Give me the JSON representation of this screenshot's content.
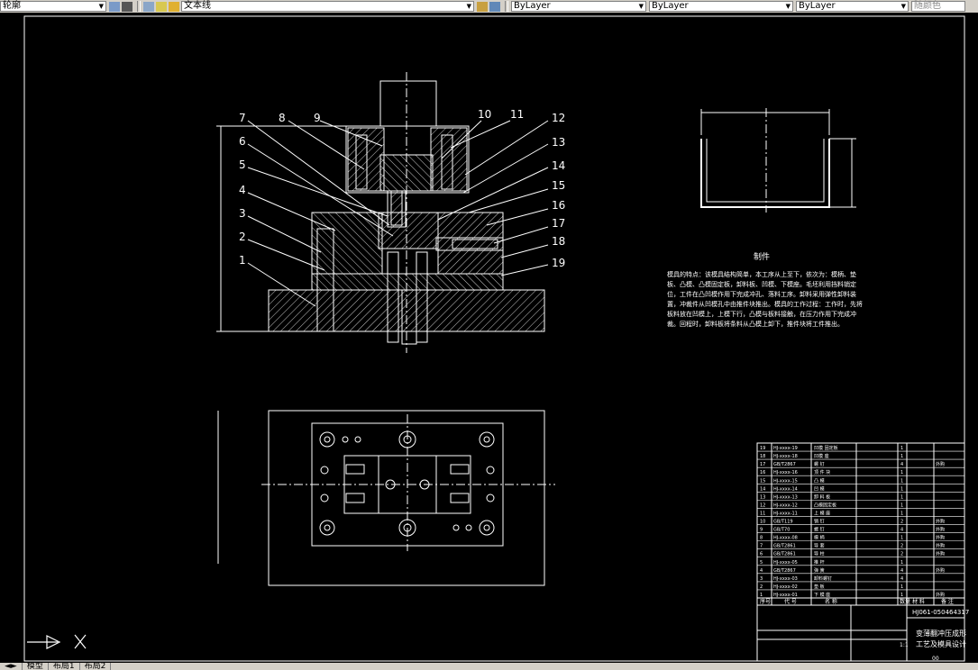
{
  "toolbar": {
    "layer_combo": "轮廓",
    "linetype_style": "文本线",
    "color_combo": "ByLayer",
    "linetype_combo": "ByLayer",
    "lineweight_combo": "ByLayer",
    "plotstyle_combo": "随颜色"
  },
  "drawing": {
    "part_numbers": [
      "1",
      "2",
      "3",
      "4",
      "5",
      "6",
      "7",
      "8",
      "9",
      "10",
      "11",
      "12",
      "13",
      "14",
      "15",
      "16",
      "17",
      "18",
      "19"
    ],
    "workpiece_caption": "制件",
    "notes": "模具的特点：该模具结构简单，本工序从上至下，依次为：模柄、垫板、凸模、凸模固定板，卸料板、凹模、下模座。毛坯利用挡料销定位，工件在凸凹模作用下完成冲孔、落料工序。卸料采用弹性卸料装置，冲裁件从凹模孔中由推件块推出。模具的工作过程：工作时，先将板料放在凹模上，上模下行，凸模与板料接触，在压力作用下完成冲裁。回程时，卸料板将条料从凸模上卸下，推件块将工件推出。",
    "title_block": {
      "drawing_no": "HJ061-050464317",
      "title_line1": "变薄翻冲压成形",
      "title_line2": "工艺及模具设计",
      "scale": "1:1",
      "sheet": "00",
      "header_no": "序号",
      "header_code": "代 号",
      "header_name": "名 称",
      "header_qty": "数量",
      "header_material": "材 料",
      "header_note": "备 注"
    },
    "bom_rows": [
      {
        "no": "19",
        "code": "HJ-xxxx-19",
        "name": "凹模 固定板",
        "qty": "1",
        "mat": "",
        "note": ""
      },
      {
        "no": "18",
        "code": "HJ-xxxx-18",
        "name": "凹模 座",
        "qty": "1",
        "mat": "",
        "note": ""
      },
      {
        "no": "17",
        "code": "GB/T2867",
        "name": "螺 钉",
        "qty": "4",
        "mat": "",
        "note": "外购"
      },
      {
        "no": "16",
        "code": "HJ-xxxx-16",
        "name": "顶 件 块",
        "qty": "1",
        "mat": "",
        "note": ""
      },
      {
        "no": "15",
        "code": "HJ-xxxx-15",
        "name": "凸 模",
        "qty": "1",
        "mat": "",
        "note": ""
      },
      {
        "no": "14",
        "code": "HJ-xxxx-14",
        "name": "凹 模",
        "qty": "1",
        "mat": "",
        "note": ""
      },
      {
        "no": "13",
        "code": "HJ-xxxx-13",
        "name": "卸 料 板",
        "qty": "1",
        "mat": "",
        "note": ""
      },
      {
        "no": "12",
        "code": "HJ-xxxx-12",
        "name": "凸模固定板",
        "qty": "1",
        "mat": "",
        "note": ""
      },
      {
        "no": "11",
        "code": "HJ-xxxx-11",
        "name": "上 模 座",
        "qty": "1",
        "mat": "",
        "note": ""
      },
      {
        "no": "10",
        "code": "GB/T119",
        "name": "销 钉",
        "qty": "2",
        "mat": "",
        "note": "外购"
      },
      {
        "no": "9",
        "code": "GB/T70",
        "name": "螺 钉",
        "qty": "4",
        "mat": "",
        "note": "外购"
      },
      {
        "no": "8",
        "code": "HJ-xxxx-08",
        "name": "模 柄",
        "qty": "1",
        "mat": "",
        "note": "外购"
      },
      {
        "no": "7",
        "code": "GB/T2861",
        "name": "导 套",
        "qty": "2",
        "mat": "",
        "note": "外购"
      },
      {
        "no": "6",
        "code": "GB/T2861",
        "name": "导 柱",
        "qty": "2",
        "mat": "",
        "note": "外购"
      },
      {
        "no": "5",
        "code": "HJ-xxxx-05",
        "name": "推 杆",
        "qty": "1",
        "mat": "",
        "note": ""
      },
      {
        "no": "4",
        "code": "GB/T2867",
        "name": "弹 簧",
        "qty": "4",
        "mat": "",
        "note": "外购"
      },
      {
        "no": "3",
        "code": "HJ-xxxx-03",
        "name": "卸料螺钉",
        "qty": "4",
        "mat": "",
        "note": ""
      },
      {
        "no": "2",
        "code": "HJ-xxxx-02",
        "name": "垫 板",
        "qty": "1",
        "mat": "",
        "note": ""
      },
      {
        "no": "1",
        "code": "HJ-xxxx-01",
        "name": "下 模 座",
        "qty": "1",
        "mat": "",
        "note": "外购"
      }
    ]
  },
  "layout_tabs": [
    "模型",
    "布局1",
    "布局2"
  ]
}
